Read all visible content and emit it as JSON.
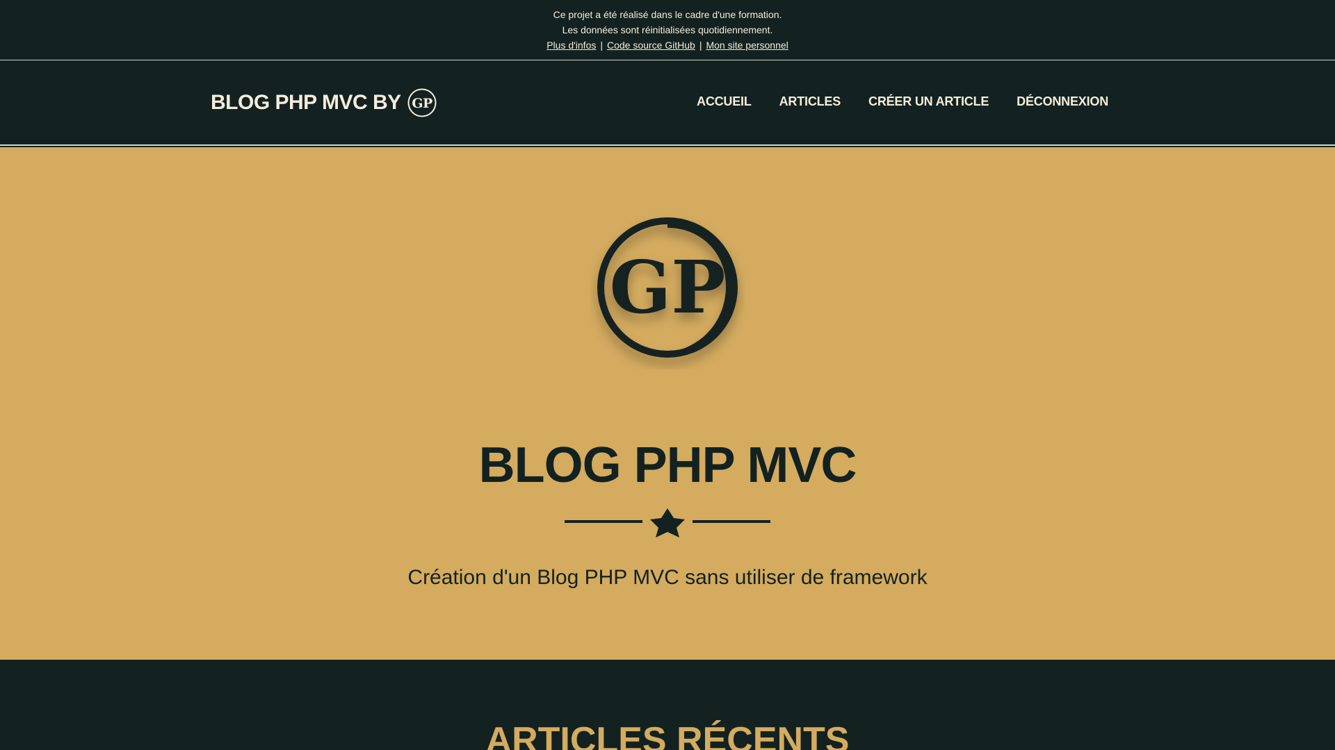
{
  "info_banner": {
    "line1": "Ce projet a été réalisé dans le cadre d'une formation.",
    "line2": "Les données sont réinitialisées quotidiennement.",
    "links": [
      {
        "label": "Plus d'infos"
      },
      {
        "label": "Code source GitHub"
      },
      {
        "label": "Mon site personnel"
      }
    ],
    "separator": "|"
  },
  "navbar": {
    "brand_text": "BLOG PHP MVC BY",
    "brand_logo_text": "GP",
    "links": [
      {
        "label": "ACCUEIL"
      },
      {
        "label": "ARTICLES"
      },
      {
        "label": "CRÉER UN ARTICLE"
      },
      {
        "label": "DÉCONNEXION"
      }
    ]
  },
  "hero": {
    "logo_text": "GP",
    "title": "BLOG PHP MVC",
    "subtitle": "Création d'un Blog PHP MVC sans utiliser de framework"
  },
  "recent": {
    "title": "ARTICLES RÉCENTS"
  },
  "colors": {
    "dark": "#132220",
    "gold": "#d4ab5f",
    "cream": "#f4eddc"
  },
  "icons": {
    "divider": "star-icon"
  }
}
